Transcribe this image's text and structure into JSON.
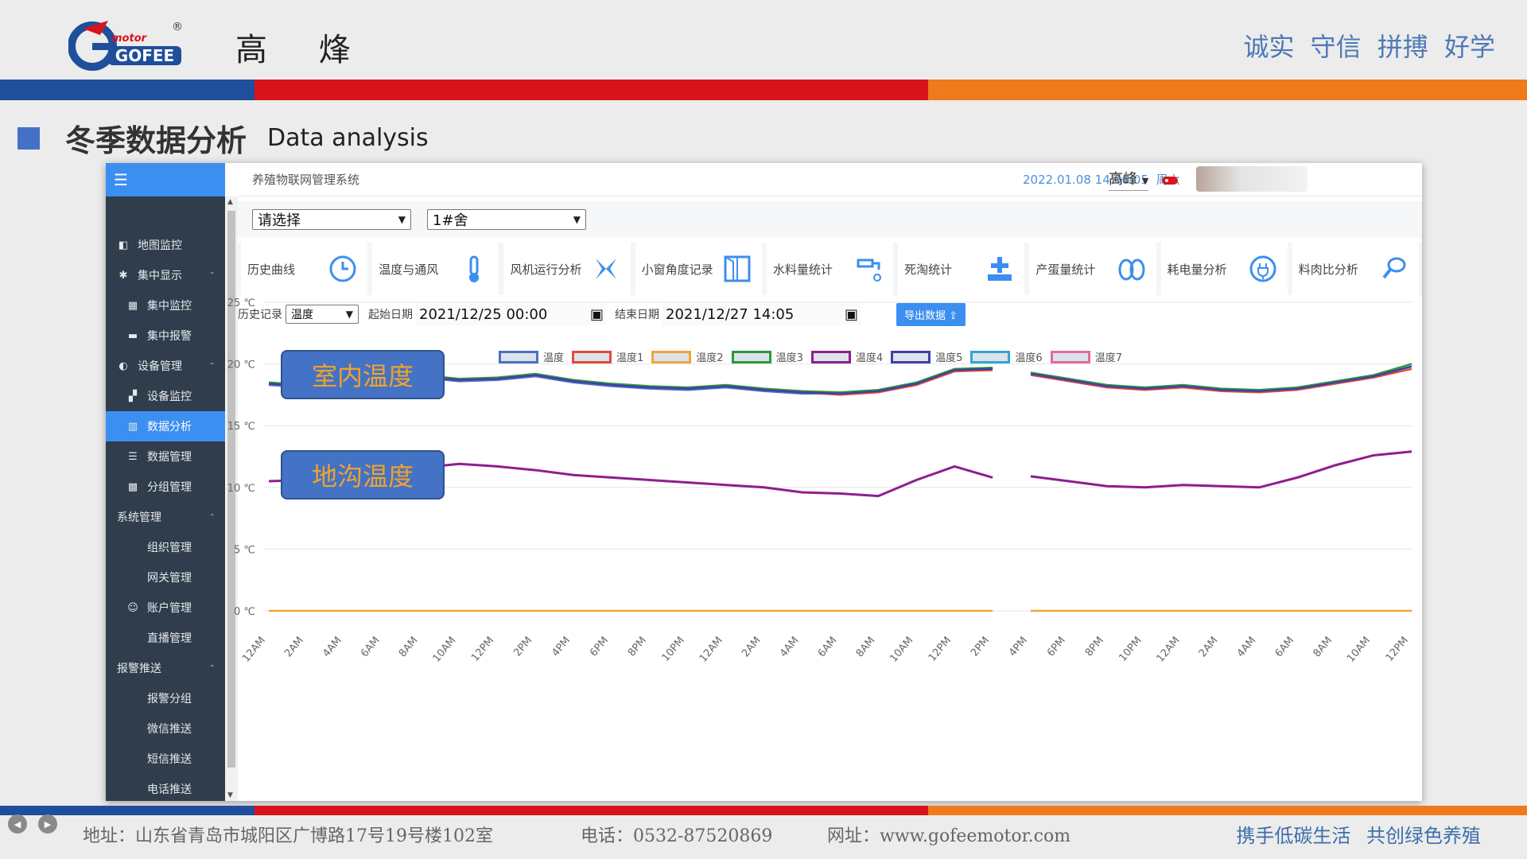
{
  "slide": {
    "logo_text": "GOFEE",
    "logo_motor": "motor",
    "logo_reg": "®",
    "brand": "高 烽",
    "motto": "诚实 守信 拼搏 好学",
    "section_title_zh": "冬季数据分析",
    "section_title_en": "Data analysis",
    "callout_indoor": "室内温度",
    "callout_ground": "地沟温度"
  },
  "app": {
    "system_name": "养殖物联网管理系统",
    "datetime": "2022.01.08 14:06:05",
    "weekday": "周六",
    "user": "高峰",
    "sidebar": [
      {
        "label": "地图监控",
        "icon": "map-icon",
        "level": 1
      },
      {
        "label": "集中显示",
        "icon": "gear-icon",
        "level": 1,
        "caret": "^"
      },
      {
        "label": "集中监控",
        "icon": "grid-icon",
        "level": 2
      },
      {
        "label": "集中报警",
        "icon": "alarm-icon",
        "level": 2
      },
      {
        "label": "设备管理",
        "icon": "device-icon",
        "level": 1,
        "caret": "^"
      },
      {
        "label": "设备监控",
        "icon": "monitor-icon",
        "level": 2
      },
      {
        "label": "数据分析",
        "icon": "bar-chart-icon",
        "level": 2,
        "active": true
      },
      {
        "label": "数据管理",
        "icon": "list-icon",
        "level": 2
      },
      {
        "label": "分组管理",
        "icon": "group-icon",
        "level": 2
      },
      {
        "label": "系统管理",
        "icon": "",
        "level": 1,
        "caret": "^"
      },
      {
        "label": "组织管理",
        "icon": "",
        "level": 3
      },
      {
        "label": "网关管理",
        "icon": "",
        "level": 3
      },
      {
        "label": "账户管理",
        "icon": "user-icon",
        "level": 2
      },
      {
        "label": "直播管理",
        "icon": "",
        "level": 3
      },
      {
        "label": "报警推送",
        "icon": "",
        "level": 1,
        "caret": "^"
      },
      {
        "label": "报警分组",
        "icon": "",
        "level": 3
      },
      {
        "label": "微信推送",
        "icon": "",
        "level": 3
      },
      {
        "label": "短信推送",
        "icon": "",
        "level": 3
      },
      {
        "label": "电话推送",
        "icon": "",
        "level": 3
      }
    ],
    "select_house_group": "请选择",
    "select_house": "1#舍",
    "tools": [
      {
        "label": "历史曲线",
        "icon": "clock-icon"
      },
      {
        "label": "温度与通风",
        "icon": "thermometer-icon"
      },
      {
        "label": "风机运行分析",
        "icon": "fan-icon"
      },
      {
        "label": "小窗角度记录",
        "icon": "window-icon"
      },
      {
        "label": "水料量统计",
        "icon": "faucet-icon"
      },
      {
        "label": "死淘统计",
        "icon": "tombstone-icon"
      },
      {
        "label": "产蛋量统计",
        "icon": "eggs-icon"
      },
      {
        "label": "耗电量分析",
        "icon": "plug-icon"
      },
      {
        "label": "料肉比分析",
        "icon": "drumstick-icon"
      }
    ],
    "history_label": "历史记录",
    "history_type": "温度",
    "start_label": "起始日期",
    "start_date": "2021/12/25 00:00",
    "end_label": "结束日期",
    "end_date": "2021/12/27 14:05",
    "export_label": "导出数据"
  },
  "footer": {
    "address": "地址：山东省青岛市城阳区广博路17号19号楼102室",
    "phone": "电话：0532-87520869",
    "website": "网址：www.gofeemotor.com",
    "slogan": "携手低碳生活 共创绿色养殖"
  },
  "colors": {
    "blue": "#1f4e9b",
    "red": "#d7141b",
    "orange": "#ee7a1c",
    "accent": "#3b8ff0",
    "sidebar": "#2f3d4c"
  },
  "chart_data": {
    "type": "line",
    "ylim": [
      0,
      25
    ],
    "yticks": [
      "25 ℃",
      "20 ℃",
      "15 ℃",
      "10 ℃",
      "5 ℃",
      "0 ℃"
    ],
    "x": [
      "12AM",
      "2AM",
      "4AM",
      "6AM",
      "8AM",
      "10AM",
      "12PM",
      "2PM",
      "4PM",
      "6PM",
      "8PM",
      "10PM",
      "12AM",
      "2AM",
      "4AM",
      "6AM",
      "8AM",
      "10AM",
      "12PM",
      "2PM",
      "4PM",
      "6PM",
      "8PM",
      "10PM",
      "12AM",
      "2AM",
      "4AM",
      "6AM",
      "8AM",
      "10AM",
      "12PM"
    ],
    "gap_between": [
      19,
      20
    ],
    "legend": [
      {
        "name": "温度",
        "color": "#4a72c4"
      },
      {
        "name": "温度1",
        "color": "#e04b3a"
      },
      {
        "name": "温度2",
        "color": "#f3a33a"
      },
      {
        "name": "温度3",
        "color": "#2a9a3a"
      },
      {
        "name": "温度4",
        "color": "#8e1e8e"
      },
      {
        "name": "温度5",
        "color": "#3f3fa8"
      },
      {
        "name": "温度6",
        "color": "#2fa6d9"
      },
      {
        "name": "温度7",
        "color": "#e46aa0"
      }
    ],
    "series": [
      {
        "name": "温度",
        "color": "#4a72c4",
        "values": [
          18.3,
          18.1,
          18.6,
          18.4,
          18.9,
          18.6,
          18.7,
          19.0,
          18.5,
          18.2,
          18.0,
          17.9,
          18.1,
          17.8,
          17.6,
          17.6,
          17.8,
          18.4,
          19.5,
          19.6,
          19.2,
          18.7,
          18.2,
          18.0,
          18.2,
          17.9,
          17.8,
          18.0,
          18.5,
          19.0,
          19.8
        ]
      },
      {
        "name": "温度1",
        "color": "#e04b3a",
        "values": [
          18.4,
          18.2,
          18.7,
          18.5,
          19.0,
          18.7,
          18.8,
          19.1,
          18.6,
          18.3,
          18.1,
          18.0,
          18.2,
          17.9,
          17.7,
          17.5,
          17.7,
          18.3,
          19.4,
          19.5,
          19.1,
          18.6,
          18.1,
          17.9,
          18.1,
          17.8,
          17.7,
          17.9,
          18.4,
          18.9,
          19.6
        ]
      },
      {
        "name": "温度2",
        "color": "#f3a33a",
        "values": [
          0,
          0,
          0,
          0,
          0,
          0,
          0,
          0,
          0,
          0,
          0,
          0,
          0,
          0,
          0,
          0,
          0,
          0,
          0,
          0,
          0,
          0,
          0,
          0,
          0,
          0,
          0,
          0,
          0,
          0,
          0
        ]
      },
      {
        "name": "温度3",
        "color": "#2a9a3a",
        "values": [
          18.5,
          18.3,
          18.8,
          18.6,
          19.1,
          18.8,
          18.9,
          19.2,
          18.7,
          18.4,
          18.2,
          18.1,
          18.3,
          18.0,
          17.8,
          17.7,
          17.9,
          18.5,
          19.6,
          19.7,
          19.3,
          18.8,
          18.3,
          18.1,
          18.3,
          18.0,
          17.9,
          18.1,
          18.6,
          19.1,
          20.0
        ]
      },
      {
        "name": "温度4",
        "color": "#8e1e8e",
        "values": [
          10.5,
          10.6,
          10.9,
          11.0,
          11.6,
          11.9,
          11.7,
          11.4,
          11.0,
          10.8,
          10.6,
          10.4,
          10.2,
          10.0,
          9.6,
          9.5,
          9.3,
          10.6,
          11.7,
          10.8,
          10.9,
          10.5,
          10.1,
          10.0,
          10.2,
          10.1,
          10.0,
          10.8,
          11.8,
          12.6,
          12.9
        ]
      },
      {
        "name": "温度5",
        "color": "#3f3fa8",
        "values": [
          18.4,
          18.2,
          18.7,
          18.5,
          19.0,
          18.7,
          18.8,
          19.1,
          18.6,
          18.3,
          18.1,
          18.0,
          18.2,
          17.9,
          17.7,
          17.6,
          17.8,
          18.4,
          19.5,
          19.6,
          19.2,
          18.7,
          18.2,
          18.0,
          18.2,
          17.9,
          17.8,
          18.0,
          18.5,
          19.0,
          19.8
        ]
      }
    ]
  }
}
